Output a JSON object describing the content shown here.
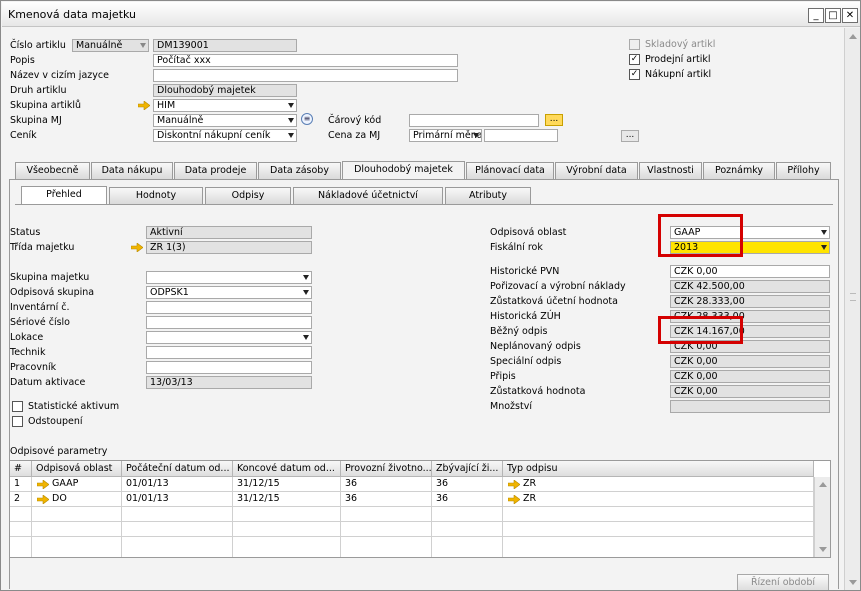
{
  "window": {
    "title": "Kmenová data majetku"
  },
  "header": {
    "item_no_label": "Číslo artiklu",
    "item_no_mode": "Manuálně",
    "item_no": "DM139001",
    "description_label": "Popis",
    "description": "Počítač xxx",
    "foreign_name_label": "Název v cizím jazyce",
    "foreign_name": "",
    "item_type_label": "Druh artiklu",
    "item_type": "Dlouhodobý majetek",
    "item_group_label": "Skupina artiklů",
    "item_group": "HIM",
    "uom_group_label": "Skupina MJ",
    "uom_group": "Manuálně",
    "price_list_label": "Ceník",
    "price_list": "Diskontní nákupní ceník",
    "barcode_label": "Čárový kód",
    "barcode": "",
    "price_uom_label": "Cena za MJ",
    "price_uom_type": "Primární měna",
    "price_uom_value": ""
  },
  "flags": {
    "inventory_item": "Skladový artikl",
    "sales_item": "Prodejní artikl",
    "purchase_item": "Nákupní artikl",
    "inventory_checked": false,
    "sales_checked": true,
    "purchase_checked": true
  },
  "tabs": [
    "Všeobecně",
    "Data nákupu",
    "Data prodeje",
    "Data zásoby",
    "Dlouhodobý majetek",
    "Plánovací data",
    "Výrobní data",
    "Vlastnosti",
    "Poznámky",
    "Přílohy"
  ],
  "subtabs": [
    "Přehled",
    "Hodnoty",
    "Odpisy",
    "Nákladové účetnictví",
    "Atributy"
  ],
  "left": {
    "status_label": "Status",
    "status": "Aktivní",
    "asset_class_label": "Třída majetku",
    "asset_class": "ZR 1(3)",
    "asset_group_label": "Skupina majetku",
    "asset_group": "",
    "depr_group_label": "Odpisová skupina",
    "depr_group": "ODPSK1",
    "inventory_no_label": "Inventární č.",
    "inventory_no": "",
    "serial_no_label": "Sériové číslo",
    "serial_no": "",
    "location_label": "Lokace",
    "location": "",
    "technician_label": "Technik",
    "technician": "",
    "employee_label": "Pracovník",
    "employee": "",
    "capitalization_date_label": "Datum aktivace",
    "capitalization_date": "13/03/13",
    "statistical_label": "Statistické aktivum",
    "retired_label": "Odstoupení"
  },
  "right": {
    "depr_area_label": "Odpisová oblast",
    "depr_area": "GAAP",
    "fiscal_year_label": "Fiskální rok",
    "fiscal_year": "2013",
    "hist_apc_label": "Historické PVN",
    "hist_apc": "CZK 0,00",
    "apc_label": "Pořizovací a výrobní náklady",
    "apc": "CZK 42.500,00",
    "nbv_label": "Zůstatková účetní hodnota",
    "nbv": "CZK 28.333,00",
    "hist_nbv_label": "Historická ZÚH",
    "hist_nbv": "CZK 28.333,00",
    "ordinary_depr_label": "Běžný odpis",
    "ordinary_depr": "CZK 14.167,00",
    "unplanned_depr_label": "Neplánovaný odpis",
    "unplanned_depr": "CZK 0,00",
    "special_depr_label": "Speciální odpis",
    "special_depr": "CZK 0,00",
    "writeup_label": "Připis",
    "writeup": "CZK 0,00",
    "salvage_label": "Zůstatková hodnota",
    "salvage": "CZK 0,00",
    "quantity_label": "Množství",
    "quantity": ""
  },
  "params": {
    "title": "Odpisové parametry",
    "columns": [
      "#",
      "Odpisová oblast",
      "Počáteční datum od...",
      "Koncové datum od...",
      "Provozní životno...",
      "Zbývající ži...",
      "Typ odpisu"
    ],
    "rows": [
      {
        "n": "1",
        "area": "GAAP",
        "start": "01/01/13",
        "end": "31/12/15",
        "life": "36",
        "remain": "36",
        "type": "ZR"
      },
      {
        "n": "2",
        "area": "DO",
        "start": "01/01/13",
        "end": "31/12/15",
        "life": "36",
        "remain": "36",
        "type": "ZR"
      }
    ]
  },
  "buttons": {
    "period_control": "Řízení období"
  },
  "colors": {
    "highlight": "#ffe400",
    "annotation": "#d40000",
    "link_arrow": "#f0b400"
  }
}
